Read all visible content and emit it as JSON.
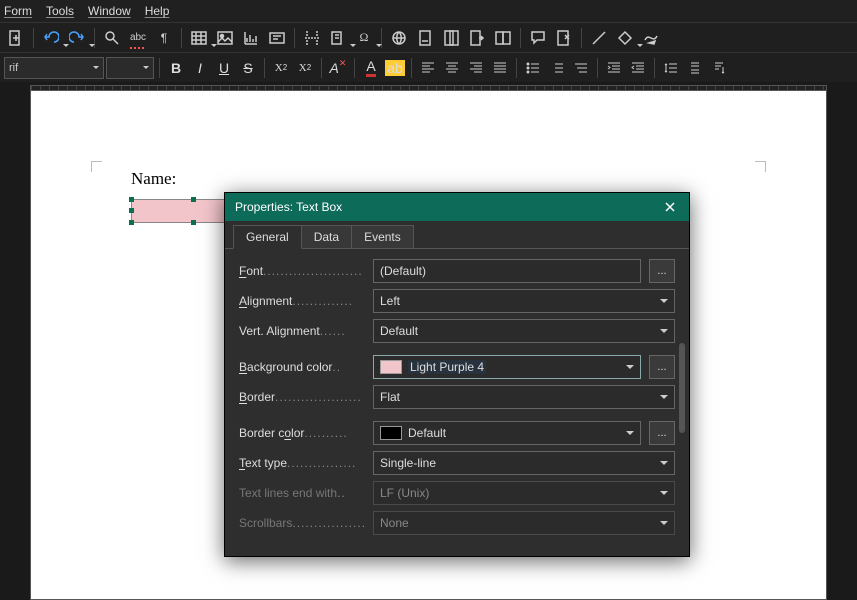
{
  "menu": {
    "form": "Form",
    "tools": "Tools",
    "window": "Window",
    "help": "Help"
  },
  "font_combo": "rif",
  "doc": {
    "label": "Name:"
  },
  "dialog": {
    "title": "Properties: Text Box",
    "tabs": {
      "general": "General",
      "data": "Data",
      "events": "Events"
    },
    "labels": {
      "font": "Font",
      "alignment": "Alignment",
      "valign": "Vert. Alignment",
      "bgcolor": "Background color",
      "border": "Border",
      "bordercolor": "Border color",
      "texttype": "Text type",
      "lineend": "Text lines end with",
      "scrollbars": "Scrollbars"
    },
    "values": {
      "font": "(Default)",
      "alignment": "Left",
      "valign": "Default",
      "bgcolor_name": "Light Purple 4",
      "bgcolor_swatch": "#f2c5ca",
      "border": "Flat",
      "bordercolor_name": "Default",
      "bordercolor_swatch": "#000000",
      "texttype": "Single-line",
      "lineend": "LF (Unix)",
      "scrollbars": "None"
    },
    "more": "..."
  }
}
